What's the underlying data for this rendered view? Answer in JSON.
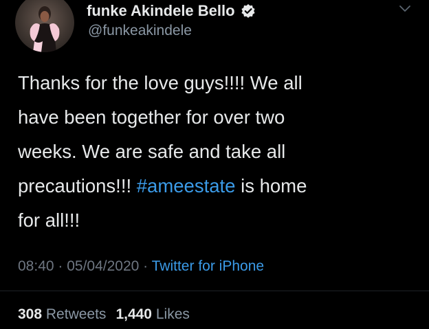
{
  "profile": {
    "display_name": "funke Akindele Bello",
    "handle": "@funkeakindele",
    "verified": true,
    "avatar_icon": "profile-photo"
  },
  "tweet": {
    "lines": [
      [
        {
          "text": "Thanks for the love guys!!!! We all",
          "type": "text"
        }
      ],
      [
        {
          "text": "have been together for over two",
          "type": "text"
        }
      ],
      [
        {
          "text": "weeks. We are safe and take all",
          "type": "text"
        }
      ],
      [
        {
          "text": "precautions!!! ",
          "type": "text"
        },
        {
          "text": "#ameestate",
          "type": "hashtag"
        },
        {
          "text": " is home",
          "type": "text"
        }
      ],
      [
        {
          "text": "for all!!!",
          "type": "text"
        }
      ]
    ]
  },
  "meta": {
    "time": "08:40",
    "separator": " · ",
    "date": "05/04/2020",
    "source": "Twitter for iPhone"
  },
  "stats": {
    "retweets_count": "308",
    "retweets_label": "Retweets",
    "likes_count": "1,440",
    "likes_label": "Likes"
  },
  "colors": {
    "background": "#000000",
    "text": "#e7e9ea",
    "secondary": "#8b98a5",
    "link": "#3b9be8"
  }
}
